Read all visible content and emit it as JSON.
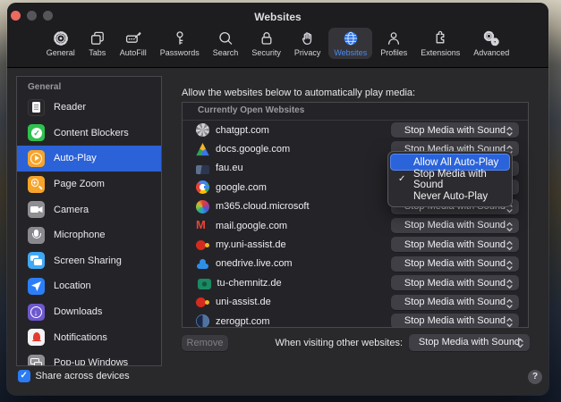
{
  "window": {
    "title": "Websites"
  },
  "toolbar": {
    "items": [
      {
        "label": "General",
        "icon": "gear",
        "selected": false
      },
      {
        "label": "Tabs",
        "icon": "tabs",
        "selected": false
      },
      {
        "label": "AutoFill",
        "icon": "autofill",
        "selected": false
      },
      {
        "label": "Passwords",
        "icon": "key",
        "selected": false
      },
      {
        "label": "Search",
        "icon": "magnifier",
        "selected": false
      },
      {
        "label": "Security",
        "icon": "lock",
        "selected": false
      },
      {
        "label": "Privacy",
        "icon": "hand",
        "selected": false
      },
      {
        "label": "Websites",
        "icon": "globe",
        "selected": true
      },
      {
        "label": "Profiles",
        "icon": "person",
        "selected": false
      },
      {
        "label": "Extensions",
        "icon": "puzzle",
        "selected": false
      },
      {
        "label": "Advanced",
        "icon": "gears",
        "selected": false
      }
    ]
  },
  "sidebar": {
    "section_header": "General",
    "items": [
      {
        "label": "Reader",
        "icon": "reader",
        "selected": false
      },
      {
        "label": "Content Blockers",
        "icon": "content-blockers",
        "selected": false
      },
      {
        "label": "Auto-Play",
        "icon": "auto-play",
        "selected": true
      },
      {
        "label": "Page Zoom",
        "icon": "page-zoom",
        "selected": false
      },
      {
        "label": "Camera",
        "icon": "camera",
        "selected": false
      },
      {
        "label": "Microphone",
        "icon": "microphone",
        "selected": false
      },
      {
        "label": "Screen Sharing",
        "icon": "screen-sharing",
        "selected": false
      },
      {
        "label": "Location",
        "icon": "location",
        "selected": false
      },
      {
        "label": "Downloads",
        "icon": "downloads",
        "selected": false
      },
      {
        "label": "Notifications",
        "icon": "notifications",
        "selected": false
      },
      {
        "label": "Pop-up Windows",
        "icon": "popup-windows",
        "selected": false
      }
    ]
  },
  "main": {
    "header": "Allow the websites below to automatically play media:",
    "table": {
      "section_header": "Currently Open Websites",
      "rows": [
        {
          "site": "chatgpt.com",
          "icon": "chatgpt",
          "policy": "Stop Media with Sound"
        },
        {
          "site": "docs.google.com",
          "icon": "gdrive",
          "policy": "Stop Media with Sound"
        },
        {
          "site": "fau.eu",
          "icon": "fau",
          "policy": "Stop Media with Sound"
        },
        {
          "site": "google.com",
          "icon": "google",
          "policy": "Stop Media with Sound"
        },
        {
          "site": "m365.cloud.microsoft",
          "icon": "m365",
          "policy": "Stop Media with Sound"
        },
        {
          "site": "mail.google.com",
          "icon": "gmail",
          "policy": "Stop Media with Sound"
        },
        {
          "site": "my.uni-assist.de",
          "icon": "uniassist",
          "policy": "Stop Media with Sound"
        },
        {
          "site": "onedrive.live.com",
          "icon": "onedrive",
          "policy": "Stop Media with Sound"
        },
        {
          "site": "tu-chemnitz.de",
          "icon": "tuchemnitz",
          "policy": "Stop Media with Sound"
        },
        {
          "site": "uni-assist.de",
          "icon": "uniassist",
          "policy": "Stop Media with Sound"
        },
        {
          "site": "zerogpt.com",
          "icon": "zerogpt",
          "policy": "Stop Media with Sound"
        }
      ]
    },
    "open_menu": {
      "anchor_site": "fau.eu",
      "items": [
        {
          "label": "Allow All Auto-Play",
          "highlighted": true,
          "checked": false
        },
        {
          "label": "Stop Media with Sound",
          "highlighted": false,
          "checked": true
        },
        {
          "label": "Never Auto-Play",
          "highlighted": false,
          "checked": false
        }
      ],
      "checkmark": "✓"
    },
    "remove_label": "Remove",
    "when_visiting_label": "When visiting other websites:",
    "when_visiting_value": "Stop Media with Sound"
  },
  "footer": {
    "share_label": "Share across devices",
    "share_checked": true,
    "checkmark": "✓",
    "help_label": "?"
  },
  "colors": {
    "accent_blue": "#2a63da",
    "toolbar_selected_blue": "#4b8bf5",
    "window_bg": "#29292c",
    "chrome_bg": "#1d1d20",
    "popup_bg": "#3f3f45"
  }
}
